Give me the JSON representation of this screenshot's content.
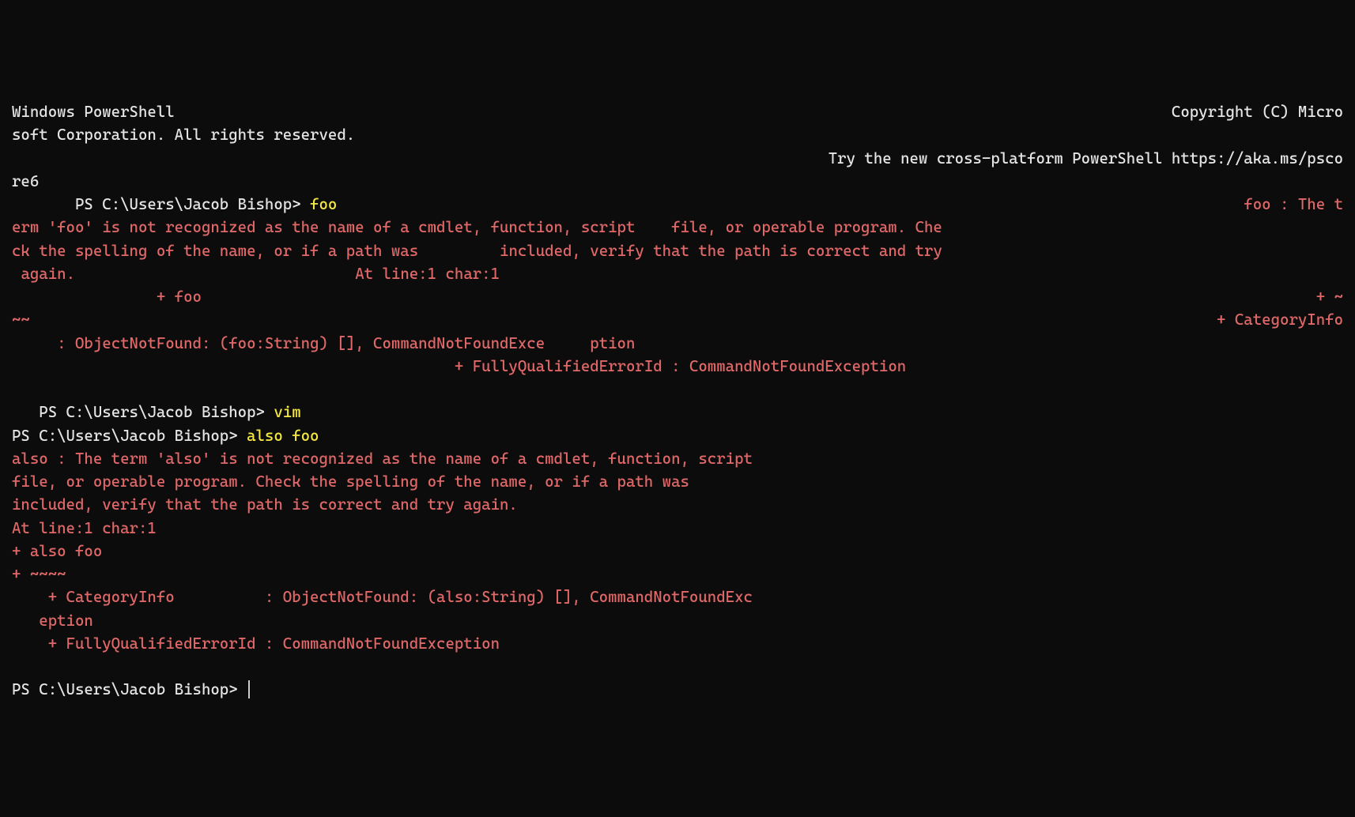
{
  "header": {
    "title_left": "Windows PowerShell",
    "title_right": "Copyright (C) Micro",
    "title_wrap": "soft Corporation. All rights reserved.",
    "try_new_left": "",
    "try_new_right": "Try the new cross-platform PowerShell https://aka.ms/psco",
    "try_new_wrap": "re6"
  },
  "line1": {
    "indent": "       ",
    "prompt": "PS C:\\Users\\Jacob Bishop> ",
    "command": "foo",
    "error_start": "foo : The t"
  },
  "error1": {
    "l1": "erm 'foo' is not recognized as the name of a cmdlet, function, script    file, or operable program. Che",
    "l2a": "ck the spelling of the name, or if a path was",
    "l2b": "included, verify that the path is correct and try",
    "l3a": " again.",
    "l3b": "At line:1 char:1",
    "l4a": "+ foo",
    "l4b": "+ ~",
    "l5a": "~~",
    "l5b": "+ CategoryInfo",
    "l6": "     : ObjectNotFound: (foo:String) [], CommandNotFoundExce     ption",
    "l7": "+ FullyQualifiedErrorId : CommandNotFoundException"
  },
  "line2": {
    "indent": "   ",
    "prompt": "PS C:\\Users\\Jacob Bishop> ",
    "command": "vim"
  },
  "line3": {
    "prompt": "PS C:\\Users\\Jacob Bishop> ",
    "command": "also foo"
  },
  "error2": {
    "l1": "also : The term 'also' is not recognized as the name of a cmdlet, function, script",
    "l2": "file, or operable program. Check the spelling of the name, or if a path was",
    "l3": "included, verify that the path is correct and try again.",
    "l4": "At line:1 char:1",
    "l5": "+ also foo",
    "l6": "+ ~~~~",
    "l7": "    + CategoryInfo          : ObjectNotFound: (also:String) [], CommandNotFoundExc",
    "l8": "   eption",
    "l9": "    + FullyQualifiedErrorId : CommandNotFoundException"
  },
  "final_prompt": "PS C:\\Users\\Jacob Bishop> "
}
